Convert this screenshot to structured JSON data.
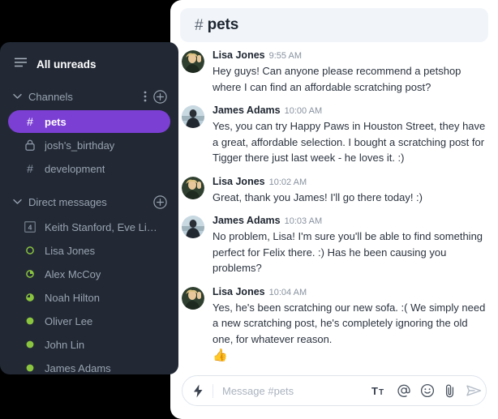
{
  "theme": {
    "page_background": "#000000",
    "sidebar_background": "#222935",
    "panel_background": "#ffffff",
    "accent": "#7b3fd4",
    "header_background": "#f1f5f9",
    "presence_green": "#8bc53f",
    "muted_text": "#98a2b0"
  },
  "sidebar": {
    "all_unreads": {
      "label": "All unreads",
      "icon": "hamburger-icon"
    },
    "channels_section": {
      "title": "Channels",
      "collapse_icon": "chevron-down-icon",
      "more_icon": "more-vertical-icon",
      "add_icon": "plus-circle-icon",
      "items": [
        {
          "name": "pets",
          "glyph": "hash-icon",
          "active": true
        },
        {
          "name": "josh's_birthday",
          "glyph": "lock-icon",
          "active": false
        },
        {
          "name": "development",
          "glyph": "hash-icon",
          "active": false
        }
      ]
    },
    "dm_section": {
      "title": "Direct messages",
      "collapse_icon": "chevron-down-icon",
      "add_icon": "plus-circle-icon",
      "items": [
        {
          "name": "Keith Stanford, Eve Libe...",
          "glyph": "group-count-icon",
          "count": "4",
          "presence": "group"
        },
        {
          "name": "Lisa Jones",
          "glyph": "presence-icon",
          "presence": "ring-empty"
        },
        {
          "name": "Alex McCoy",
          "glyph": "presence-icon",
          "presence": "ring-quarter"
        },
        {
          "name": "Noah Hilton",
          "glyph": "presence-icon",
          "presence": "ring-half"
        },
        {
          "name": "Oliver Lee",
          "glyph": "presence-icon",
          "presence": "solid"
        },
        {
          "name": "John Lin",
          "glyph": "presence-icon",
          "presence": "solid"
        },
        {
          "name": "James Adams",
          "glyph": "presence-icon",
          "presence": "solid"
        }
      ]
    }
  },
  "channel": {
    "hash": "#",
    "name": "pets"
  },
  "messages": [
    {
      "author": "Lisa Jones",
      "time": "9:55 AM",
      "avatar": "lisa-avatar",
      "text": "Hey guys! Can anyone please recommend a petshop where I can find an affordable scratching post?",
      "reaction": ""
    },
    {
      "author": "James Adams",
      "time": "10:00 AM",
      "avatar": "james-avatar",
      "text": "Yes, you can try Happy Paws in Houston Street, they have a great, affordable selection. I bought a scratching post for Tigger there just last week - he loves it. :)",
      "reaction": ""
    },
    {
      "author": "Lisa Jones",
      "time": "10:02 AM",
      "avatar": "lisa-avatar",
      "text": "Great, thank you James! I'll go there today! :)",
      "reaction": ""
    },
    {
      "author": "James Adams",
      "time": "10:03 AM",
      "avatar": "james-avatar",
      "text": "No problem, Lisa! I'm sure you'll be able to find something perfect for Felix there. :) Has he been causing you problems?",
      "reaction": ""
    },
    {
      "author": "Lisa Jones",
      "time": "10:04 AM",
      "avatar": "lisa-avatar",
      "text": "Yes, he's been scratching our new sofa. :( We simply need a new scratching post, he's completely ignoring the old one, for whatever reason.",
      "reaction": "👍"
    }
  ],
  "composer": {
    "placeholder": "Message #pets",
    "value": "",
    "bolt_icon": "lightning-bolt-icon",
    "actions": [
      {
        "icon": "text-format-icon",
        "label": "Tt"
      },
      {
        "icon": "mention-icon",
        "label": "@"
      },
      {
        "icon": "emoji-icon",
        "label": "smiley"
      },
      {
        "icon": "attachment-icon",
        "label": "paperclip"
      },
      {
        "icon": "send-icon",
        "label": "send"
      }
    ]
  }
}
